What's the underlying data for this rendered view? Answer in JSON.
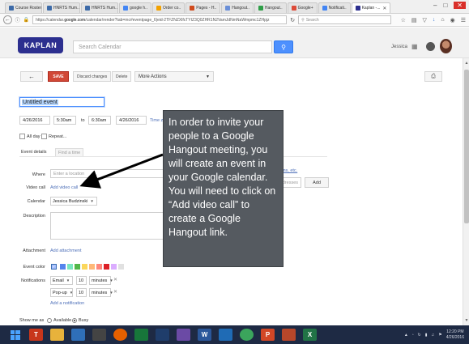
{
  "browser": {
    "tabs": [
      {
        "label": "Course Roster",
        "color": "#3c6aa8"
      },
      {
        "label": "HNRTS Hum..",
        "color": "#3c6aa8"
      },
      {
        "label": "HNRTS Hum..",
        "color": "#3c6aa8"
      },
      {
        "label": "google h..",
        "color": "#4285f4"
      },
      {
        "label": "Order co..",
        "color": "#f2a100"
      },
      {
        "label": "Pages - H..",
        "color": "#d04a1c"
      },
      {
        "label": "Hangout..",
        "color": "#6a8fd8"
      },
      {
        "label": "Hangout..",
        "color": "#2e9e47"
      },
      {
        "label": "Google+",
        "color": "#dd4b39"
      },
      {
        "label": "Notificati..",
        "color": "#4285f4"
      },
      {
        "label": "Kaplan -...",
        "color": "#2c2f8f"
      }
    ],
    "url_prefix": "https://calendar.",
    "url_domain": "google.com",
    "url_rest": "/calendar/render?tab=mc#eventpage_6|eid-2TFZNZXlfcTYIZ3Q0ZHR1N2VamJdNmNaWmpmc1ZHpjz",
    "search_placeholder": "Search"
  },
  "header": {
    "logo_text": "KAPLAN",
    "search_placeholder": "Search Calendar",
    "user_name": "Jessica"
  },
  "toolbar": {
    "save_label": "SAVE",
    "discard_label": "Discard changes",
    "delete_label": "Delete",
    "more_actions_label": "More Actions"
  },
  "event": {
    "title": "Untitled event",
    "start_date": "4/26/2016",
    "start_time": "5:30am",
    "to_label": "to",
    "end_time": "6:30am",
    "end_date": "4/26/2016",
    "timezone_label": "Time zone",
    "all_day_label": "All day",
    "repeat_label": "Repeat..."
  },
  "tabs": {
    "details_label": "Event details",
    "find_time_label": "Find a time"
  },
  "form": {
    "where_label": "Where",
    "where_placeholder": "Enter a location",
    "video_call_label": "Video call",
    "add_video_call_label": "Add video call",
    "calendar_label": "Calendar",
    "calendar_value": "Jessica Budzinski",
    "description_label": "Description",
    "attachment_label": "Attachment",
    "add_attachment_label": "Add attachment",
    "event_color_label": "Event color",
    "colors": [
      "#a4bdfc",
      "#5484ed",
      "#7ae7bf",
      "#51b749",
      "#fbd75b",
      "#ffb878",
      "#ff887c",
      "#dc2127",
      "#dbadff",
      "#e1e1e1"
    ],
    "notifications_label": "Notifications",
    "notification_rows": [
      {
        "type": "Email",
        "amount": "10",
        "unit": "minutes"
      },
      {
        "type": "Pop-up",
        "amount": "10",
        "unit": "minutes"
      }
    ],
    "add_notification_label": "Add a notification",
    "show_me_as_label": "Show me as",
    "available_label": "Available",
    "busy_label": "Busy",
    "guest_partial_link": "rooms, etc.",
    "guest_placeholder": "email addresses",
    "add_guest_label": "Add"
  },
  "callout": {
    "text": "In order to invite your people to a Google Hangout meeting, you will create an event in your Google calendar.  You will need to click on “Add video call” to create a Google Hangout link."
  },
  "taskbar": {
    "time": "12:20 PM",
    "date": "4/26/2016"
  }
}
